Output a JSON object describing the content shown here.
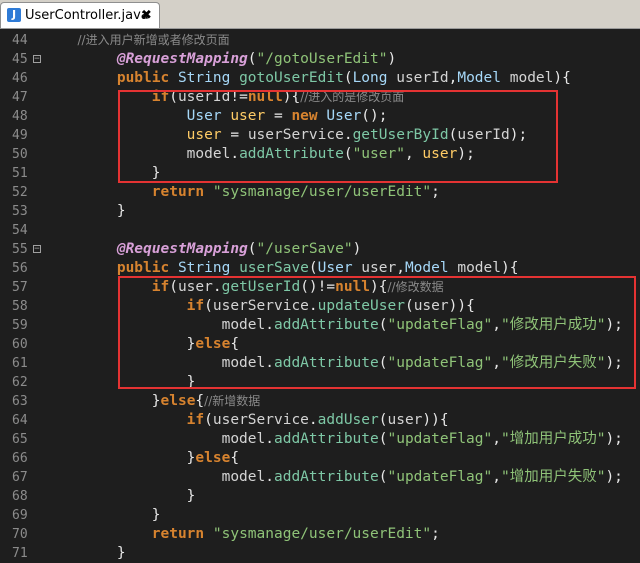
{
  "tab": {
    "label": "UserController.java",
    "close": "✖"
  },
  "lines": [
    {
      "n": "44",
      "tokens": [
        [
          "cm",
          "        //进入用户新增或者修改页面"
        ]
      ]
    },
    {
      "n": "45",
      "fold": "−",
      "tokens": [
        [
          "an",
          "        @RequestMapping"
        ],
        [
          "pu",
          "("
        ],
        [
          "st",
          "\"/gotoUserEdit\""
        ],
        [
          "pu",
          ")"
        ]
      ]
    },
    {
      "n": "46",
      "tokens": [
        [
          "kw",
          "        public "
        ],
        [
          "ty",
          "String "
        ],
        [
          "fn",
          "gotoUserEdit"
        ],
        [
          "pu",
          "("
        ],
        [
          "ty",
          "Long "
        ],
        [
          "id",
          "userId"
        ],
        [
          "pu",
          ","
        ],
        [
          "ty",
          "Model "
        ],
        [
          "id",
          "model"
        ],
        [
          "pu",
          "){"
        ]
      ]
    },
    {
      "n": "47",
      "tokens": [
        [
          "kw",
          "            if"
        ],
        [
          "pu",
          "("
        ],
        [
          "id",
          "userId"
        ],
        [
          "pu",
          "!="
        ],
        [
          "kw",
          "null"
        ],
        [
          "pu",
          ")"
        ],
        [
          "pu",
          "{"
        ],
        [
          "cm",
          "//进入的是修改页面"
        ]
      ]
    },
    {
      "n": "48",
      "tokens": [
        [
          "ty",
          "                User "
        ],
        [
          "var",
          "user"
        ],
        [
          "pu",
          " = "
        ],
        [
          "kw",
          "new "
        ],
        [
          "ty",
          "User"
        ],
        [
          "pu",
          "();"
        ]
      ]
    },
    {
      "n": "49",
      "tokens": [
        [
          "var",
          "                user"
        ],
        [
          "pu",
          " = "
        ],
        [
          "id",
          "userService"
        ],
        [
          "pu",
          "."
        ],
        [
          "fn",
          "getUserById"
        ],
        [
          "pu",
          "("
        ],
        [
          "id",
          "userId"
        ],
        [
          "pu",
          ");"
        ]
      ]
    },
    {
      "n": "50",
      "tokens": [
        [
          "id",
          "                model"
        ],
        [
          "pu",
          "."
        ],
        [
          "fn",
          "addAttribute"
        ],
        [
          "pu",
          "("
        ],
        [
          "st",
          "\"user\""
        ],
        [
          "pu",
          ", "
        ],
        [
          "var",
          "user"
        ],
        [
          "pu",
          ");"
        ]
      ]
    },
    {
      "n": "51",
      "tokens": [
        [
          "pu",
          "            }"
        ]
      ]
    },
    {
      "n": "52",
      "tokens": [
        [
          "kw",
          "            return "
        ],
        [
          "st",
          "\"sysmanage/user/userEdit\""
        ],
        [
          "pu",
          ";"
        ]
      ]
    },
    {
      "n": "53",
      "tokens": [
        [
          "pu",
          "        }"
        ]
      ]
    },
    {
      "n": "54",
      "tokens": []
    },
    {
      "n": "55",
      "fold": "−",
      "tokens": [
        [
          "an",
          "        @RequestMapping"
        ],
        [
          "pu",
          "("
        ],
        [
          "st",
          "\"/userSave\""
        ],
        [
          "pu",
          ")"
        ]
      ]
    },
    {
      "n": "56",
      "tokens": [
        [
          "kw",
          "        public "
        ],
        [
          "ty",
          "String "
        ],
        [
          "fn",
          "userSave"
        ],
        [
          "pu",
          "("
        ],
        [
          "ty",
          "User "
        ],
        [
          "id",
          "user"
        ],
        [
          "pu",
          ","
        ],
        [
          "ty",
          "Model "
        ],
        [
          "id",
          "model"
        ],
        [
          "pu",
          "){"
        ]
      ]
    },
    {
      "n": "57",
      "tokens": [
        [
          "kw",
          "            if"
        ],
        [
          "pu",
          "("
        ],
        [
          "id",
          "user"
        ],
        [
          "pu",
          "."
        ],
        [
          "fn",
          "getUserId"
        ],
        [
          "pu",
          "()!="
        ],
        [
          "kw",
          "null"
        ],
        [
          "pu",
          ")"
        ],
        [
          "pu",
          "{"
        ],
        [
          "cm",
          "//修改数据"
        ]
      ]
    },
    {
      "n": "58",
      "tokens": [
        [
          "kw",
          "                if"
        ],
        [
          "pu",
          "("
        ],
        [
          "id",
          "userService"
        ],
        [
          "pu",
          "."
        ],
        [
          "fn",
          "updateUser"
        ],
        [
          "pu",
          "("
        ],
        [
          "id",
          "user"
        ],
        [
          "pu",
          "))"
        ],
        [
          "pu",
          "{"
        ]
      ]
    },
    {
      "n": "59",
      "tokens": [
        [
          "id",
          "                    model"
        ],
        [
          "pu",
          "."
        ],
        [
          "fn",
          "addAttribute"
        ],
        [
          "pu",
          "("
        ],
        [
          "st",
          "\"updateFlag\""
        ],
        [
          "pu",
          ","
        ],
        [
          "st",
          "\"修改用户成功\""
        ],
        [
          "pu",
          ");"
        ]
      ]
    },
    {
      "n": "60",
      "tokens": [
        [
          "pu",
          "                }"
        ],
        [
          "kw",
          "else"
        ],
        [
          "pu",
          "{"
        ]
      ]
    },
    {
      "n": "61",
      "tokens": [
        [
          "id",
          "                    model"
        ],
        [
          "pu",
          "."
        ],
        [
          "fn",
          "addAttribute"
        ],
        [
          "pu",
          "("
        ],
        [
          "st",
          "\"updateFlag\""
        ],
        [
          "pu",
          ","
        ],
        [
          "st",
          "\"修改用户失败\""
        ],
        [
          "pu",
          ");"
        ]
      ]
    },
    {
      "n": "62",
      "tokens": [
        [
          "pu",
          "                }"
        ]
      ]
    },
    {
      "n": "63",
      "tokens": [
        [
          "pu",
          "            }"
        ],
        [
          "kw",
          "else"
        ],
        [
          "pu",
          "{"
        ],
        [
          "cm",
          "//新增数据"
        ]
      ]
    },
    {
      "n": "64",
      "tokens": [
        [
          "kw",
          "                if"
        ],
        [
          "pu",
          "("
        ],
        [
          "id",
          "userService"
        ],
        [
          "pu",
          "."
        ],
        [
          "fn",
          "addUser"
        ],
        [
          "pu",
          "("
        ],
        [
          "id",
          "user"
        ],
        [
          "pu",
          "))"
        ],
        [
          "pu",
          "{"
        ]
      ]
    },
    {
      "n": "65",
      "tokens": [
        [
          "id",
          "                    model"
        ],
        [
          "pu",
          "."
        ],
        [
          "fn",
          "addAttribute"
        ],
        [
          "pu",
          "("
        ],
        [
          "st",
          "\"updateFlag\""
        ],
        [
          "pu",
          ","
        ],
        [
          "st",
          "\"增加用户成功\""
        ],
        [
          "pu",
          ");"
        ]
      ]
    },
    {
      "n": "66",
      "tokens": [
        [
          "pu",
          "                }"
        ],
        [
          "kw",
          "else"
        ],
        [
          "pu",
          "{"
        ]
      ]
    },
    {
      "n": "67",
      "tokens": [
        [
          "id",
          "                    model"
        ],
        [
          "pu",
          "."
        ],
        [
          "fn",
          "addAttribute"
        ],
        [
          "pu",
          "("
        ],
        [
          "st",
          "\"updateFlag\""
        ],
        [
          "pu",
          ","
        ],
        [
          "st",
          "\"增加用户失败\""
        ],
        [
          "pu",
          ");"
        ]
      ]
    },
    {
      "n": "68",
      "tokens": [
        [
          "pu",
          "                }"
        ]
      ]
    },
    {
      "n": "69",
      "tokens": [
        [
          "pu",
          "            }"
        ]
      ]
    },
    {
      "n": "70",
      "tokens": [
        [
          "kw",
          "            return "
        ],
        [
          "st",
          "\"sysmanage/user/userEdit\""
        ],
        [
          "pu",
          ";"
        ]
      ]
    },
    {
      "n": "71",
      "tokens": [
        [
          "pu",
          "        }"
        ]
      ]
    }
  ],
  "colors": {
    "highlight_box": "#e53333",
    "background": "#1e1e1e"
  }
}
